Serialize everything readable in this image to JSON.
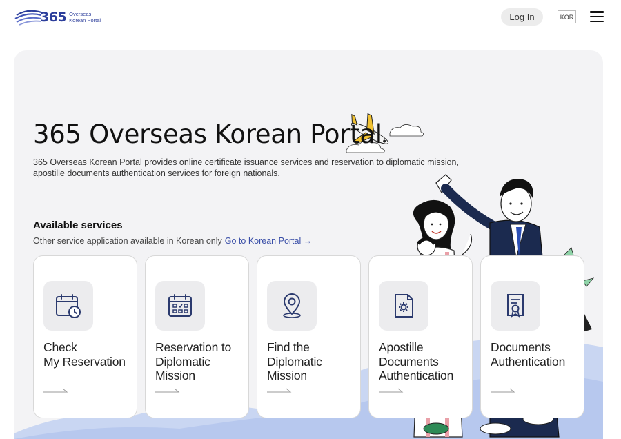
{
  "header": {
    "logo_number": "365",
    "logo_line1": "Overseas",
    "logo_line2": "Korean Portal",
    "login_label": "Log In",
    "language_label": "KOR",
    "menu_icon": "hamburger-menu-icon"
  },
  "hero": {
    "title": "365 Overseas Korean Portal",
    "description": "365 Overseas Korean Portal provides online certificate issuance services and reservation to diplomatic mission, apostille documents authentication services for foreign nationals."
  },
  "services": {
    "title": "Available services",
    "subtitle": "Other service application available in Korean only",
    "link_label": "Go to Korean Portal →",
    "items": [
      {
        "label": "Check\nMy Reservation",
        "icon": "calendar-clock-icon"
      },
      {
        "label": "Reservation to\nDiplomatic\nMission",
        "icon": "calendar-grid-icon"
      },
      {
        "label": "Find the\nDiplomatic\nMission",
        "icon": "location-pin-icon"
      },
      {
        "label": "Apostille\nDocuments\nAuthentication",
        "icon": "document-gear-icon"
      },
      {
        "label": "Documents\nAuthentication",
        "icon": "certificate-icon"
      }
    ]
  },
  "colors": {
    "brand": "#2c3e9b",
    "icon_stroke": "#2b3a6e",
    "hero_bg": "#f3f3f5",
    "link": "#3a4fa8"
  }
}
